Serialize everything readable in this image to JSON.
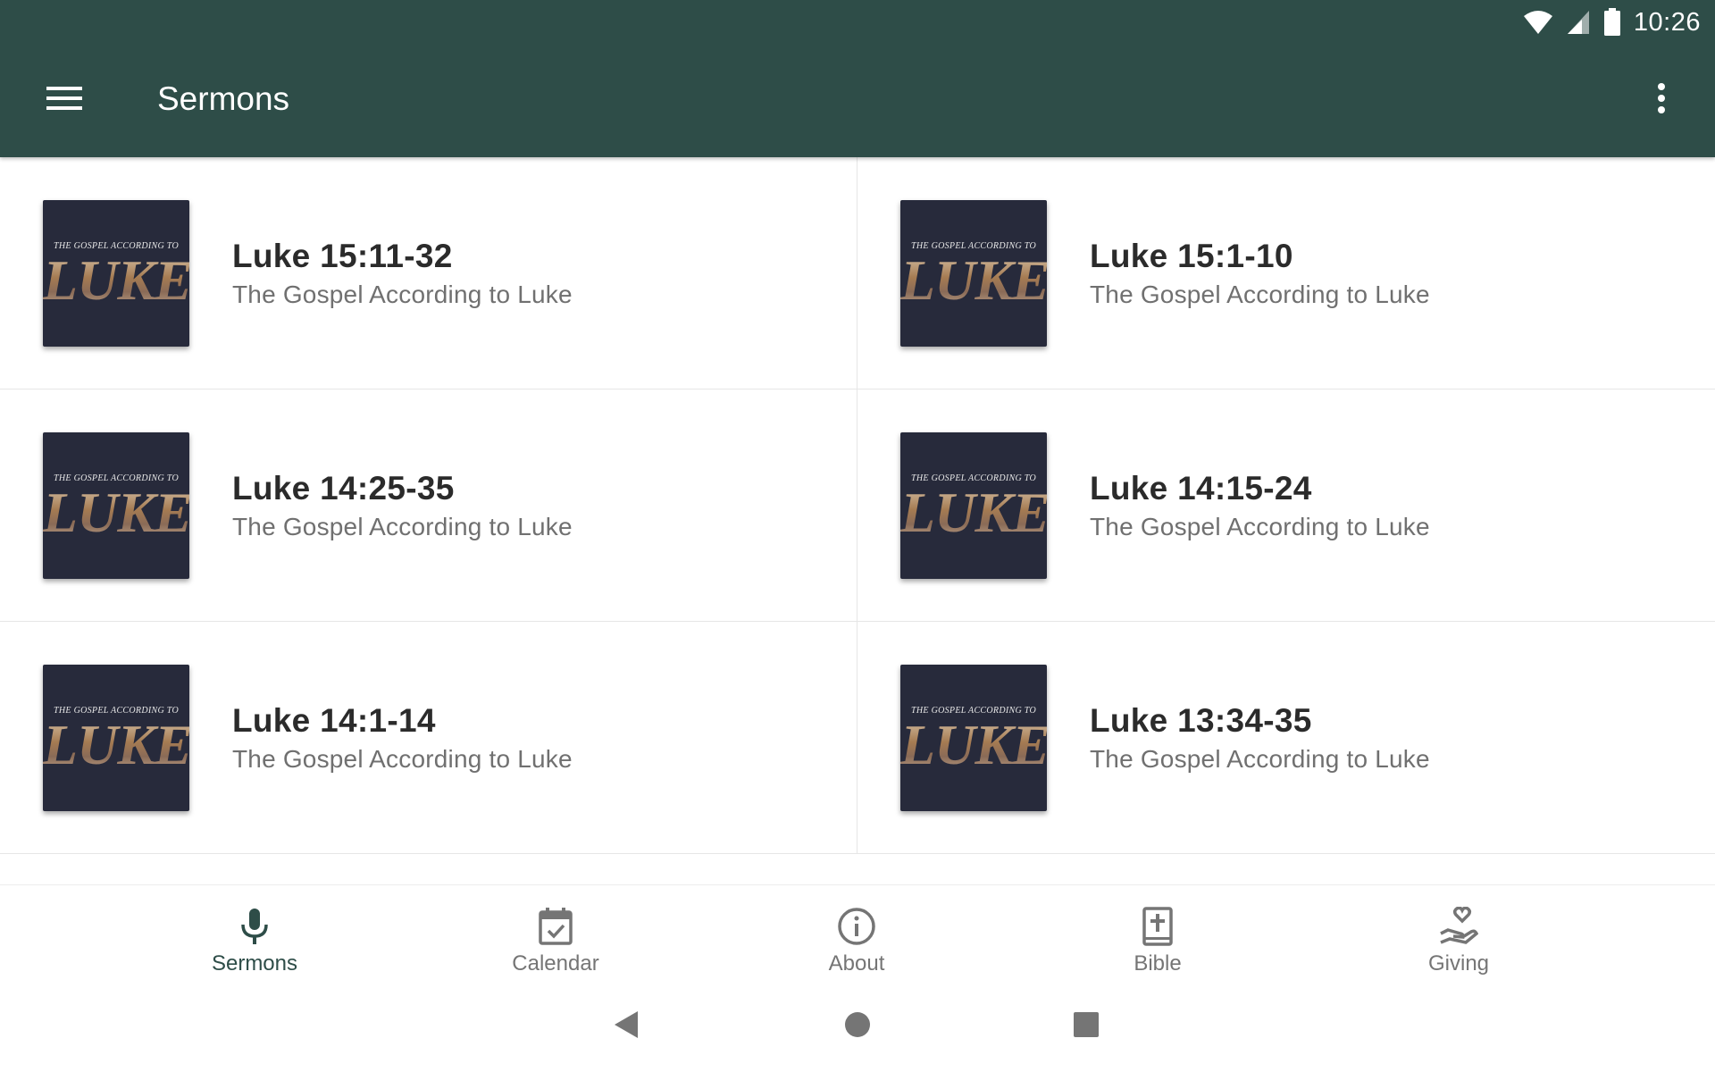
{
  "status_bar": {
    "time": "10:26",
    "icons": [
      "wifi-icon",
      "signal-icon",
      "battery-icon"
    ]
  },
  "app_bar": {
    "title": "Sermons",
    "menu_icon": "hamburger-menu-icon",
    "overflow_icon": "more-vert-icon",
    "background": "#2e4d48"
  },
  "sermons": [
    {
      "title": "Luke 15:11-32",
      "subtitle": "The Gospel According to Luke",
      "artwork_small": "THE GOSPEL ACCORDING TO",
      "artwork_large": "LUKE"
    },
    {
      "title": "Luke 15:1-10",
      "subtitle": "The Gospel According to Luke",
      "artwork_small": "THE GOSPEL ACCORDING TO",
      "artwork_large": "LUKE"
    },
    {
      "title": "Luke 14:25-35",
      "subtitle": "The Gospel According to Luke",
      "artwork_small": "THE GOSPEL ACCORDING TO",
      "artwork_large": "LUKE"
    },
    {
      "title": "Luke 14:15-24",
      "subtitle": "The Gospel According to Luke",
      "artwork_small": "THE GOSPEL ACCORDING TO",
      "artwork_large": "LUKE"
    },
    {
      "title": "Luke 14:1-14",
      "subtitle": "The Gospel According to Luke",
      "artwork_small": "THE GOSPEL ACCORDING TO",
      "artwork_large": "LUKE"
    },
    {
      "title": "Luke 13:34-35",
      "subtitle": "The Gospel According to Luke",
      "artwork_small": "THE GOSPEL ACCORDING TO",
      "artwork_large": "LUKE"
    }
  ],
  "bottom_nav": [
    {
      "label": "Sermons",
      "icon": "microphone-icon",
      "active": true
    },
    {
      "label": "Calendar",
      "icon": "calendar-check-icon",
      "active": false
    },
    {
      "label": "About",
      "icon": "info-icon",
      "active": false
    },
    {
      "label": "Bible",
      "icon": "bible-icon",
      "active": false
    },
    {
      "label": "Giving",
      "icon": "giving-hand-heart-icon",
      "active": false
    }
  ],
  "system_nav": [
    "back-icon",
    "home-icon",
    "recents-icon"
  ],
  "colors": {
    "accent": "#2e4d48",
    "inactive": "#757575",
    "artwork_bg": "#272a3b"
  }
}
